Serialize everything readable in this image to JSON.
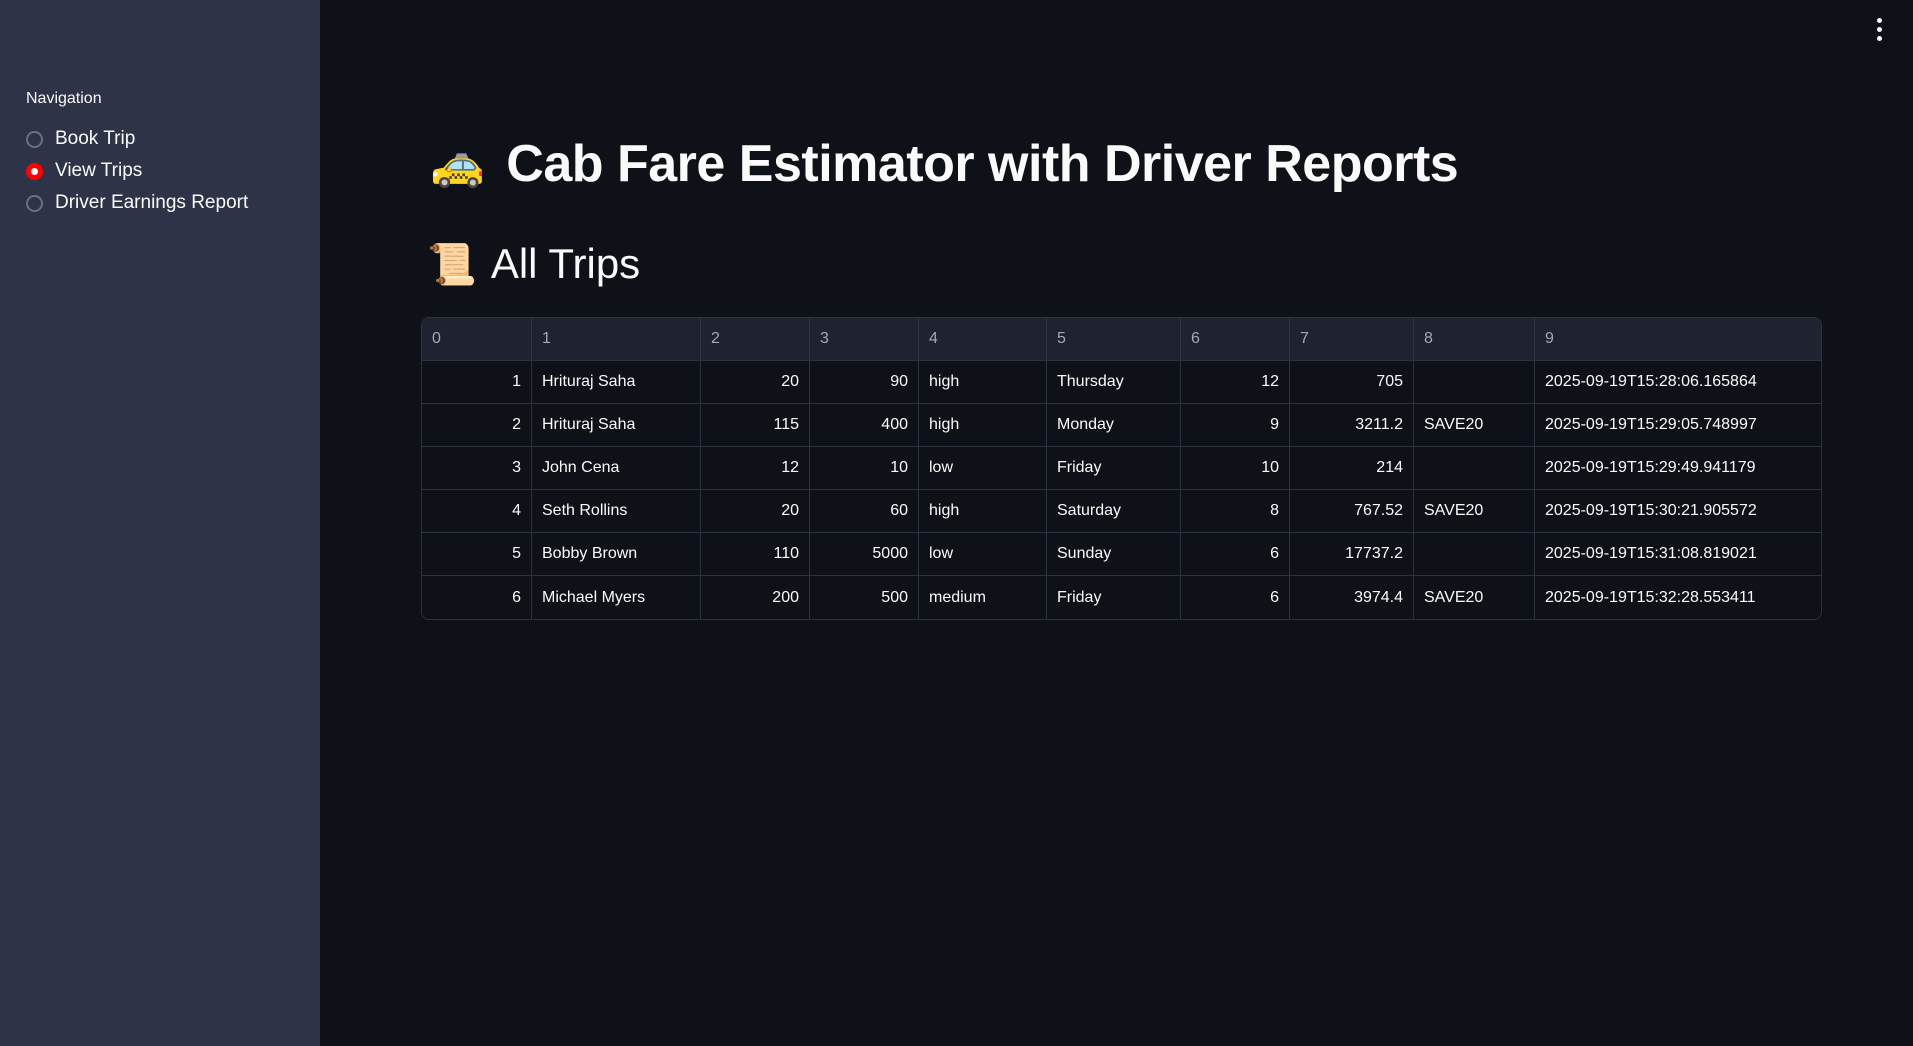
{
  "sidebar": {
    "heading": "Navigation",
    "items": [
      {
        "label": "Book Trip",
        "selected": false
      },
      {
        "label": "View Trips",
        "selected": true
      },
      {
        "label": "Driver Earnings Report",
        "selected": false
      }
    ],
    "accent_color": "#ff0000"
  },
  "header": {
    "menu_icon": "vertical-ellipsis-icon"
  },
  "main": {
    "title_emoji": "🚕",
    "title": "Cab Fare Estimator with Driver Reports",
    "section_emoji": "📜",
    "section_title": "All Trips",
    "table": {
      "columns": [
        "0",
        "1",
        "2",
        "3",
        "4",
        "5",
        "6",
        "7",
        "8",
        "9"
      ],
      "rows": [
        [
          "1",
          "Hrituraj Saha",
          "20",
          "90",
          "high",
          "Thursday",
          "12",
          "705",
          "",
          "2025-09-19T15:28:06.165864"
        ],
        [
          "2",
          "Hrituraj Saha",
          "115",
          "400",
          "high",
          "Monday",
          "9",
          "3211.2",
          "SAVE20",
          "2025-09-19T15:29:05.748997"
        ],
        [
          "3",
          "John Cena",
          "12",
          "10",
          "low",
          "Friday",
          "10",
          "214",
          "",
          "2025-09-19T15:29:49.941179"
        ],
        [
          "4",
          "Seth Rollins",
          "20",
          "60",
          "high",
          "Saturday",
          "8",
          "767.52",
          "SAVE20",
          "2025-09-19T15:30:21.905572"
        ],
        [
          "5",
          "Bobby Brown",
          "110",
          "5000",
          "low",
          "Sunday",
          "6",
          "17737.2",
          "",
          "2025-09-19T15:31:08.819021"
        ],
        [
          "6",
          "Michael Myers",
          "200",
          "500",
          "medium",
          "Friday",
          "6",
          "3974.4",
          "SAVE20",
          "2025-09-19T15:32:28.553411"
        ]
      ]
    }
  }
}
